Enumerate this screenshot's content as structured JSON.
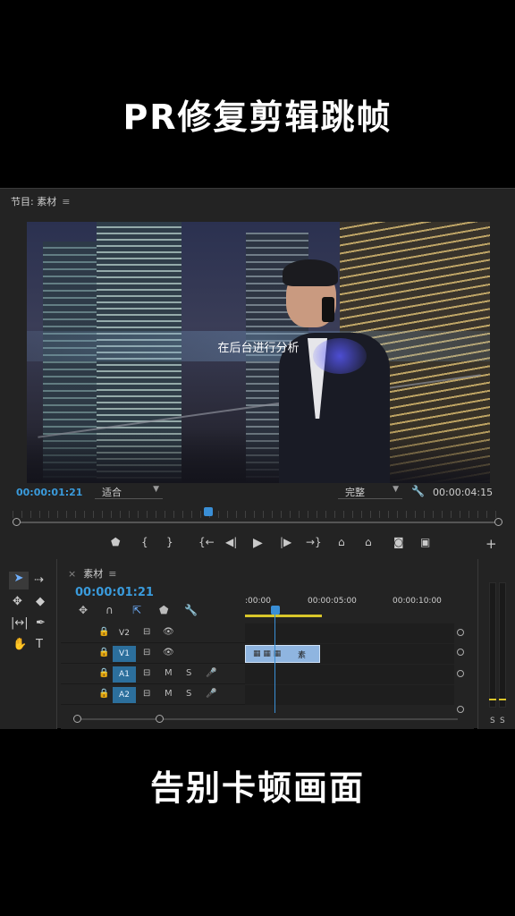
{
  "overlay": {
    "top_title": "PR修复剪辑跳帧",
    "bottom_title": "告别卡顿画面"
  },
  "program_monitor": {
    "tab_label": "节目: 素材",
    "menu_icon": "≡",
    "subtitle": "在后台进行分析",
    "timecode_current": "00:00:01:21",
    "fit_label": "适合",
    "quality_label": "完整",
    "timecode_total": "00:00:04:15",
    "transport_icons": [
      "marker-icon",
      "mark-in-icon",
      "mark-out-icon",
      "go-to-in-icon",
      "step-back-icon",
      "play-icon",
      "step-forward-icon",
      "go-to-out-icon",
      "lift-icon",
      "extract-icon",
      "export-frame-icon",
      "compare-icon",
      "add-button-icon"
    ]
  },
  "tools": {
    "items": [
      "selection-tool",
      "track-select-tool",
      "ripple-edit-tool",
      "razor-tool",
      "slip-tool",
      "pen-tool",
      "hand-tool",
      "type-tool"
    ]
  },
  "timeline": {
    "tab_close": "×",
    "tab_label": "素材",
    "menu_icon": "≡",
    "timecode": "00:00:01:21",
    "time_labels": [
      ":00:00",
      "00:00:05:00",
      "00:00:10:00"
    ],
    "tracks": [
      {
        "label": "V2",
        "type": "video",
        "targeted": false
      },
      {
        "label": "V1",
        "type": "video",
        "targeted": true
      },
      {
        "label": "A1",
        "type": "audio",
        "targeted": true,
        "m": "M",
        "s": "S"
      },
      {
        "label": "A2",
        "type": "audio",
        "targeted": true,
        "m": "M",
        "s": "S"
      }
    ],
    "clip_label": "素"
  },
  "audio_meter": {
    "labels": [
      "S",
      "S"
    ]
  },
  "colors": {
    "accent_blue": "#3a9bdc",
    "work_area_yellow": "#d8c62a",
    "clip_blue": "#8fb5e0",
    "panel_bg": "#232323"
  }
}
